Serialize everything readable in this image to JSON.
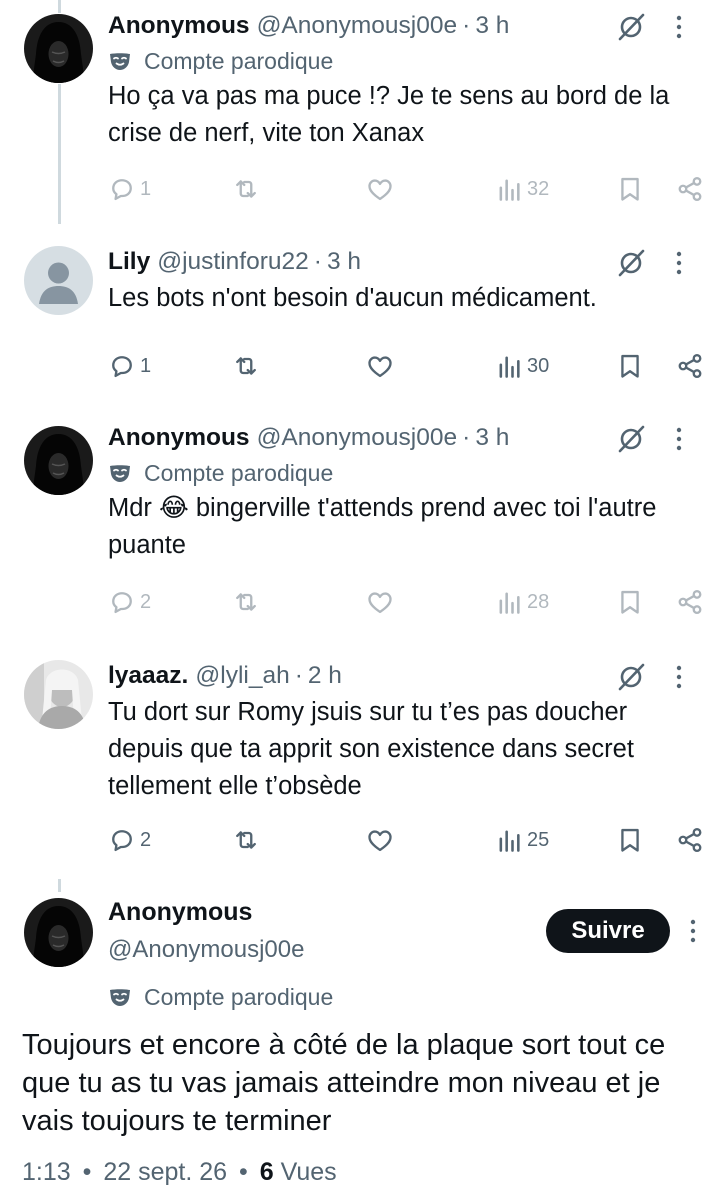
{
  "replies": [
    {
      "avatar": "hooded-figure-avatar",
      "name": "Anonymous",
      "handle": "@Anonymousj00e",
      "time": "3 h",
      "badge": "Compte parodique",
      "text": "Ho ça va pas ma puce !? Je te sens au bord de la crise de nerf, vite ton Xanax",
      "replies_count": "1",
      "views": "32",
      "faded": true
    },
    {
      "avatar": "default-profile-avatar",
      "name": "Lily",
      "handle": "@justinforu22",
      "time": "3 h",
      "badge": "",
      "text": "Les bots n'ont besoin d'aucun médicament.",
      "replies_count": "1",
      "views": "30",
      "faded": false
    },
    {
      "avatar": "hooded-figure-avatar",
      "name": "Anonymous",
      "handle": "@Anonymousj00e",
      "time": "3 h",
      "badge": "Compte parodique",
      "text": "Mdr 😂 bingerville t'attends prend avec toi l'autre puante",
      "replies_count": "2",
      "views": "28",
      "faded": true
    },
    {
      "avatar": "photo-avatar",
      "name": "lyaaaz.",
      "handle": "@lyli_ah",
      "time": "2 h",
      "badge": "",
      "text": "Tu dort sur Romy jsuis sur tu t’es pas doucher depuis que ta apprit son existence dans secret tellement elle t’obsède",
      "replies_count": "2",
      "views": "25",
      "faded": false
    }
  ],
  "separator": "·",
  "main_post": {
    "name": "Anonymous",
    "handle": "@Anonymousj00e",
    "follow_label": "Suivre",
    "badge": "Compte parodique",
    "text": "Toujours et encore à côté de la plaque sort tout ce que tu as tu vas jamais atteindre mon niveau et je vais toujours te terminer",
    "time": "1:13",
    "date": "22 sept. 26",
    "views_count": "6",
    "views_label": "Vues"
  },
  "colors": {
    "text": "#0f1419",
    "secondary": "#536471",
    "thread_line": "#cfd9de",
    "follow_bg": "#0f1419"
  }
}
